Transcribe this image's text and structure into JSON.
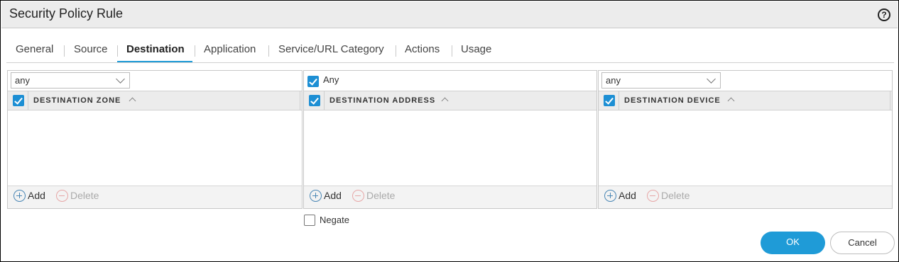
{
  "dialog": {
    "title": "Security Policy Rule",
    "help_icon": "?"
  },
  "tabs": [
    {
      "label": "General",
      "active": false
    },
    {
      "label": "Source",
      "active": false
    },
    {
      "label": "Destination",
      "active": true
    },
    {
      "label": "Application",
      "active": false
    },
    {
      "label": "Service/URL Category",
      "active": false
    },
    {
      "label": "Actions",
      "active": false
    },
    {
      "label": "Usage",
      "active": false
    }
  ],
  "panels": {
    "zone": {
      "select_value": "any",
      "header": "DESTINATION ZONE",
      "add_label": "Add",
      "delete_label": "Delete"
    },
    "address": {
      "any_label": "Any",
      "any_checked": true,
      "header": "DESTINATION ADDRESS",
      "add_label": "Add",
      "delete_label": "Delete"
    },
    "device": {
      "select_value": "any",
      "header": "DESTINATION DEVICE",
      "add_label": "Add",
      "delete_label": "Delete"
    }
  },
  "negate": {
    "label": "Negate",
    "checked": false
  },
  "buttons": {
    "ok": "OK",
    "cancel": "Cancel"
  },
  "colors": {
    "accent": "#1f9bd7",
    "checkbox": "#1d8fd4",
    "add_icon": "#4a87b5",
    "delete_icon_disabled": "#e7a7a7"
  }
}
